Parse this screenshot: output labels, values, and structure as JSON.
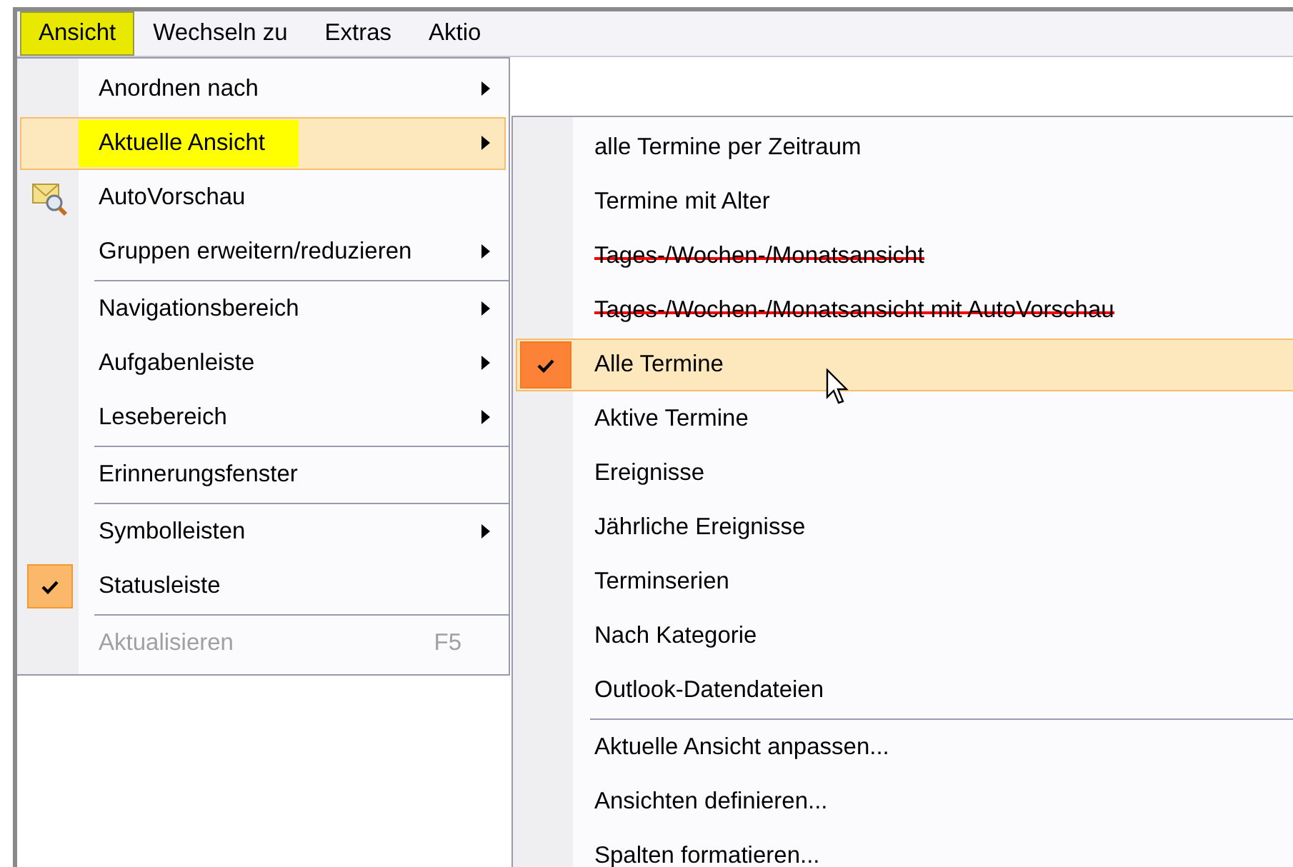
{
  "menu_bar": [
    {
      "label": "Ansicht",
      "selected": true
    },
    {
      "label": "Wechseln zu",
      "selected": false
    },
    {
      "label": "Extras",
      "selected": false
    },
    {
      "label": "Aktio",
      "selected": false
    }
  ],
  "menu": [
    {
      "kind": "item",
      "label": "Anordnen nach",
      "submenu": true,
      "selected": false,
      "checked": false,
      "disabled": false,
      "marked": false
    },
    {
      "kind": "item",
      "label": "Aktuelle Ansicht",
      "submenu": true,
      "selected": true,
      "checked": false,
      "disabled": false,
      "marked": true
    },
    {
      "kind": "icon_item",
      "label": "AutoVorschau",
      "submenu": false,
      "selected": false,
      "checked": false,
      "disabled": false,
      "marked": false
    },
    {
      "kind": "item",
      "label": "Gruppen erweitern/reduzieren",
      "submenu": true,
      "selected": false,
      "checked": false,
      "disabled": false,
      "marked": false
    },
    {
      "kind": "separator"
    },
    {
      "kind": "item",
      "label": "Navigationsbereich",
      "submenu": true,
      "selected": false,
      "checked": false,
      "disabled": false,
      "marked": false
    },
    {
      "kind": "item",
      "label": "Aufgabenleiste",
      "submenu": true,
      "selected": false,
      "checked": false,
      "disabled": false,
      "marked": false
    },
    {
      "kind": "item",
      "label": "Lesebereich",
      "submenu": true,
      "selected": false,
      "checked": false,
      "disabled": false,
      "marked": false
    },
    {
      "kind": "separator"
    },
    {
      "kind": "item",
      "label": "Erinnerungsfenster",
      "submenu": false,
      "selected": false,
      "checked": false,
      "disabled": false,
      "marked": false
    },
    {
      "kind": "separator"
    },
    {
      "kind": "item",
      "label": "Symbolleisten",
      "submenu": true,
      "selected": false,
      "checked": false,
      "disabled": false,
      "marked": false
    },
    {
      "kind": "item",
      "label": "Statusleiste",
      "submenu": false,
      "selected": false,
      "checked": true,
      "disabled": false,
      "marked": false
    },
    {
      "kind": "separator"
    },
    {
      "kind": "item",
      "label": "Aktualisieren",
      "shortcut": "F5",
      "submenu": false,
      "selected": false,
      "checked": false,
      "disabled": true,
      "marked": false
    }
  ],
  "submenu": [
    {
      "kind": "item",
      "label": "alle Termine per Zeitraum",
      "selected": false,
      "checked": false,
      "struck": false
    },
    {
      "kind": "item",
      "label": "Termine mit Alter",
      "selected": false,
      "checked": false,
      "struck": false
    },
    {
      "kind": "item",
      "label": "Tages-/Wochen-/Monatsansicht",
      "selected": false,
      "checked": false,
      "struck": true
    },
    {
      "kind": "item",
      "label": "Tages-/Wochen-/Monatsansicht mit AutoVorschau",
      "selected": false,
      "checked": false,
      "struck": true
    },
    {
      "kind": "item",
      "label": "Alle Termine",
      "selected": true,
      "checked": true,
      "struck": false
    },
    {
      "kind": "item",
      "label": "Aktive Termine",
      "selected": false,
      "checked": false,
      "struck": false
    },
    {
      "kind": "item",
      "label": "Ereignisse",
      "selected": false,
      "checked": false,
      "struck": false
    },
    {
      "kind": "item",
      "label": "Jährliche Ereignisse",
      "selected": false,
      "checked": false,
      "struck": false
    },
    {
      "kind": "item",
      "label": "Terminserien",
      "selected": false,
      "checked": false,
      "struck": false
    },
    {
      "kind": "item",
      "label": "Nach Kategorie",
      "selected": false,
      "checked": false,
      "struck": false
    },
    {
      "kind": "item",
      "label": "Outlook-Datendateien",
      "selected": false,
      "checked": false,
      "struck": false
    },
    {
      "kind": "separator"
    },
    {
      "kind": "item",
      "label": "Aktuelle Ansicht anpassen...",
      "selected": false,
      "checked": false,
      "struck": false
    },
    {
      "kind": "item",
      "label": "Ansichten definieren...",
      "selected": false,
      "checked": false,
      "struck": false
    },
    {
      "kind": "item",
      "label": "Spalten formatieren...",
      "selected": false,
      "checked": false,
      "struck": false
    }
  ]
}
